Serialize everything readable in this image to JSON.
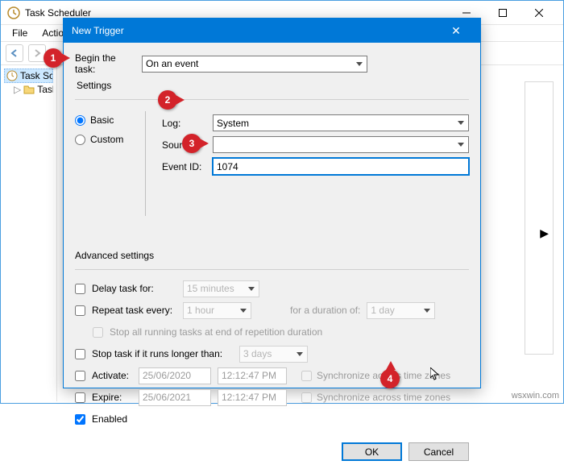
{
  "parent": {
    "title": "Task Scheduler",
    "menu": [
      "File",
      "Action"
    ],
    "tree": {
      "root": "Task Sche",
      "child": "Task S"
    }
  },
  "modal": {
    "title": "New Trigger",
    "begin_label": "Begin the task:",
    "begin_value": "On an event",
    "settings_label": "Settings",
    "basic": "Basic",
    "custom": "Custom",
    "log_label": "Log:",
    "log_value": "System",
    "source_label": "Source:",
    "source_value": "",
    "eventid_label": "Event ID:",
    "eventid_value": "1074",
    "adv_label": "Advanced settings",
    "delay_label": "Delay task for:",
    "delay_value": "15 minutes",
    "repeat_label": "Repeat task every:",
    "repeat_value": "1 hour",
    "duration_label": "for a duration of:",
    "duration_value": "1 day",
    "stop_repeat": "Stop all running tasks at end of repetition duration",
    "stop_longer_label": "Stop task if it runs longer than:",
    "stop_longer_value": "3 days",
    "activate_label": "Activate:",
    "activate_date": "25/06/2020",
    "activate_time": "12:12:47 PM",
    "expire_label": "Expire:",
    "expire_date": "25/06/2021",
    "expire_time": "12:12:47 PM",
    "sync_tz": "Synchronize across time zones",
    "enabled_label": "Enabled",
    "ok": "OK",
    "cancel": "Cancel"
  },
  "callouts": {
    "c1": "1",
    "c2": "2",
    "c3": "3",
    "c4": "4"
  },
  "watermark": "wsxwin.com"
}
